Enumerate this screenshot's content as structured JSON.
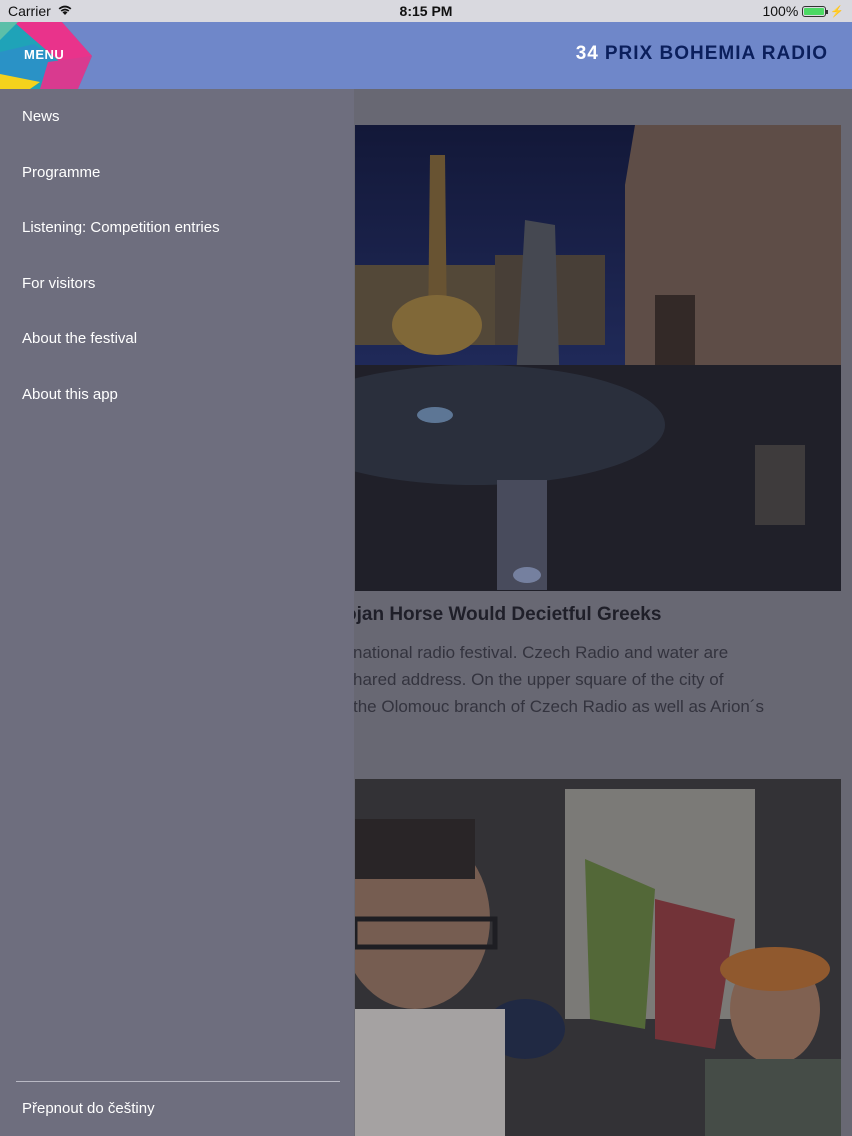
{
  "status_bar": {
    "carrier": "Carrier",
    "time": "8:15 PM",
    "battery": "100%",
    "battery_level": 1.0
  },
  "header": {
    "menu_label": "MENU",
    "edition": "34",
    "title": "PRIX BOHEMIA RADIO"
  },
  "drawer": {
    "items": [
      {
        "label": "News"
      },
      {
        "label": "Programme"
      },
      {
        "label": "Listening: Competition entries"
      },
      {
        "label": "For visitors"
      },
      {
        "label": "About the festival"
      },
      {
        "label": "About this app"
      }
    ],
    "language_switch": "Přepnout do češtiny"
  },
  "content": {
    "cards": [
      {
        "title": "ojan Horse Would Decietful Greeks",
        "text_lines": [
          "national radio festival. Czech Radio and water are",
          "hared address. On the upper square of the city of",
          "the Olomouc branch of Czech Radio as well as Arion´s"
        ]
      }
    ]
  },
  "colors": {
    "header_bg": "#6f87c9",
    "brand_text": "#0b1f5c",
    "drawer_bg": "#6e6e7e",
    "drawer_text": "#ffffff"
  }
}
